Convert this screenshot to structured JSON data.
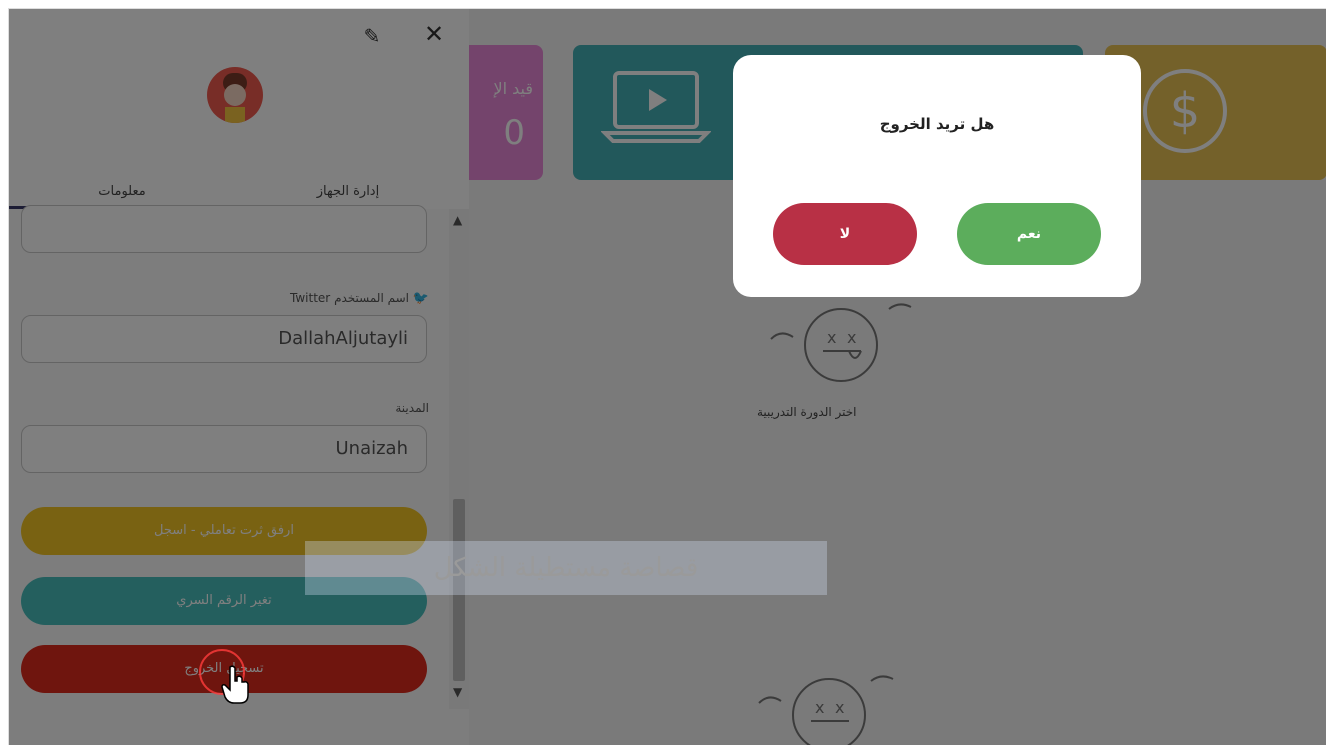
{
  "dashboard": {
    "pink_tile": {
      "label": "قيد الإ",
      "count": "0"
    },
    "empty_state": {
      "caption": "اختر الدورة التدريبية"
    },
    "colors": {
      "pink": "#e888d8",
      "teal": "#45b0b6",
      "gold": "#e8c254"
    }
  },
  "panel": {
    "tabs": [
      {
        "label": "معلومات",
        "active": true
      },
      {
        "label": "إدارة الجهاز",
        "active": false
      }
    ],
    "twitter": {
      "label": "Twitter اسم المستخدم",
      "value": "DallahAljutayli"
    },
    "city": {
      "label": "المدينة",
      "value": "Unaizah"
    },
    "buttons": {
      "gold": "ارفق ثرت تعاملي - اسجل",
      "teal": "تغير الرقم السري",
      "red": "تسجيل الخروج"
    },
    "icons": {
      "edit": "pencil-icon",
      "close": "close-icon"
    }
  },
  "snip_tooltip": "قصاصة مستطيلة الشكل",
  "modal": {
    "title": "هل تريد الخروج",
    "yes_label": "نعم",
    "no_label": "لا",
    "colors": {
      "yes": "#5cad5c",
      "no": "#b83045"
    }
  }
}
